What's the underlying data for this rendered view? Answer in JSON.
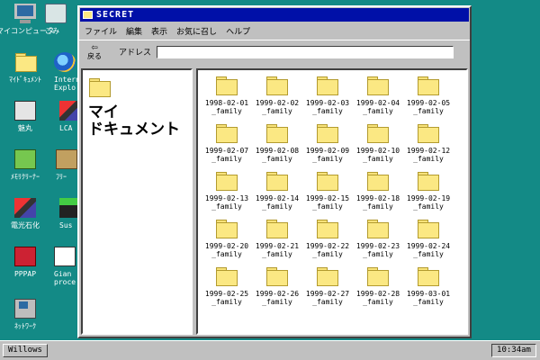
{
  "desktop": {
    "icons": [
      {
        "label": "マイコンピュータ",
        "icon": "computer-icon"
      },
      {
        "label": "ごみ",
        "icon": "recycle-bin-icon"
      },
      {
        "label": "ﾏｲﾄﾞｷｭﾒﾝﾄ",
        "icon": "folder-icon"
      },
      {
        "label": "Internet Explo",
        "icon": "internet-explorer-icon"
      },
      {
        "label": "魅丸",
        "icon": "app-icon"
      },
      {
        "label": "LCA",
        "icon": "app-icon"
      },
      {
        "label": "ﾒﾓﾘｸﾘｰﾅｰ",
        "icon": "memory-cleaner-icon"
      },
      {
        "label": "ﾌﾘｰ",
        "icon": "box-icon"
      },
      {
        "label": "電光石化",
        "icon": "tool-icon"
      },
      {
        "label": "Sus",
        "icon": "app-icon"
      },
      {
        "label": "PPPAP",
        "icon": "ppap-icon"
      },
      {
        "label": "Gian proce",
        "icon": "document-icon"
      },
      {
        "label": "ﾈｯﾄﾜｰｸ",
        "icon": "network-icon"
      }
    ]
  },
  "window": {
    "title": "SECRET",
    "menu": [
      "ファイル",
      "編集",
      "表示",
      "お気に召し",
      "ヘルプ"
    ],
    "back_label": "戻る",
    "address_label": "アドレス",
    "address_value": "",
    "left_title_line1": "マイ",
    "left_title_line2": "ドキュメント",
    "files": [
      "1998-02-01\n_family",
      "1999-02-02\n_family",
      "1999-02-03\n_family",
      "1999-02-04\n_family",
      "1999-02-05\n_family",
      "1999-02-07\n_family",
      "1999-02-08\n_family",
      "1999-02-09\n_family",
      "1999-02-10\n_family",
      "1999-02-12\n_family",
      "1999-02-13\n_family",
      "1999-02-14\n_family",
      "1999-02-15\n_family",
      "1999-02-18\n_family",
      "1999-02-19\n_family",
      "1999-02-20\n_family",
      "1999-02-21\n_family",
      "1999-02-22\n_family",
      "1999-02-23\n_family",
      "1999-02-24\n_family",
      "1999-02-25\n_family",
      "1999-02-26\n_family",
      "1999-02-27\n_family",
      "1999-02-28\n_family",
      "1999-03-01\n_family"
    ]
  },
  "taskbar": {
    "start_label": "Willows",
    "clock": "10:34am"
  },
  "colors": {
    "desktop": "#138a86",
    "titlebar": "#0010a8",
    "folder": "#fbe883"
  }
}
